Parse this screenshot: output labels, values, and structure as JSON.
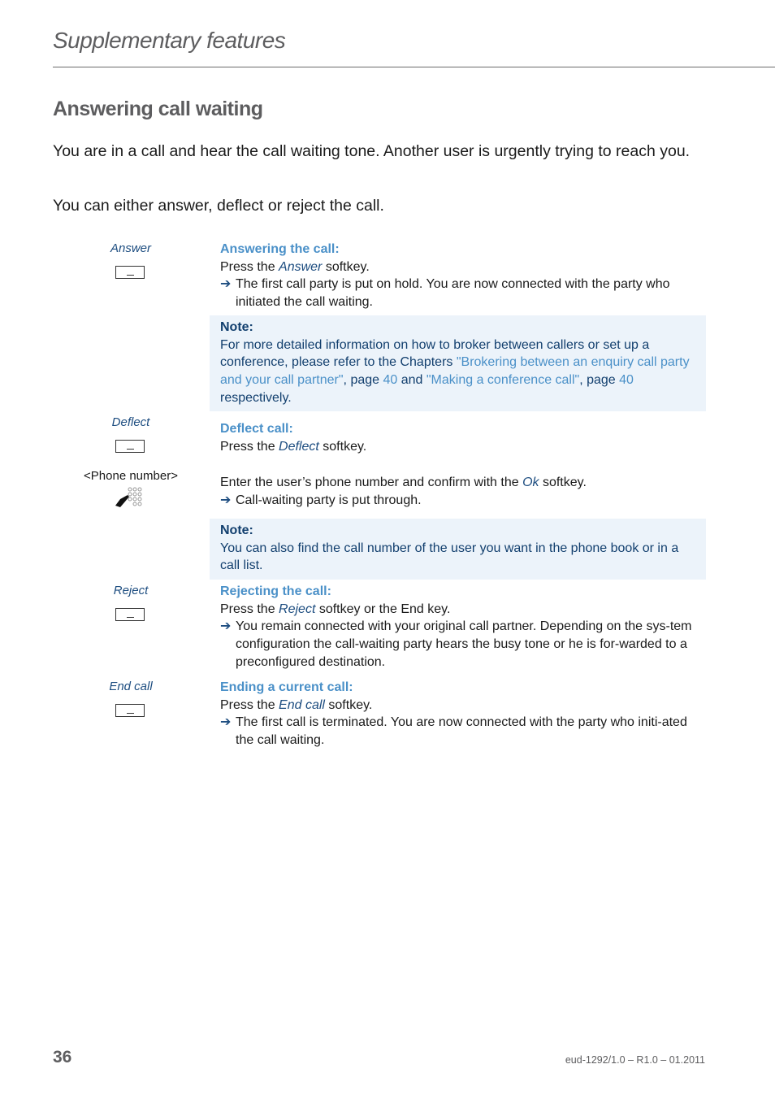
{
  "header": {
    "running_head": "Supplementary features"
  },
  "section": {
    "title": "Answering call waiting",
    "intro_1": "You are in a call and hear the call waiting tone. Another user is urgently trying to reach you.",
    "intro_2": "You can either answer, deflect or reject the call."
  },
  "answer": {
    "key_label": "Answer",
    "key_icon": "softkey-icon",
    "title": "Answering the call:",
    "press_pre": "Press the ",
    "press_key": "Answer",
    "press_post": " softkey.",
    "arrow": "➔",
    "result": "The first call party is put on hold. You are now connected with the party who initiated the call waiting."
  },
  "note1": {
    "title": "Note:",
    "text_1": "For more detailed information on how to broker between callers or set up a conference, please refer to the Chapters ",
    "link_1": "\"Brokering between an enquiry call party and your call partner\"",
    "text_2": ", page ",
    "page_1": "40",
    "text_3": " and ",
    "link_2": "\"Making a conference call\"",
    "text_4": ", page ",
    "page_2": "40",
    "text_5": " respectively."
  },
  "deflect": {
    "key_label": "Deflect",
    "key_icon": "softkey-icon",
    "title": "Deflect call:",
    "press_pre": "Press the ",
    "press_key": "Deflect",
    "press_post": " softkey.",
    "phone_label": "<Phone number>",
    "phone_icon": "keypad-icon",
    "enter_pre": "Enter the user’s phone number and confirm with the ",
    "enter_key": "Ok",
    "enter_post": " softkey.",
    "arrow": "➔",
    "result": "Call-waiting party is put through."
  },
  "note2": {
    "title": "Note:",
    "text": "You can also find the call number of the user you want in the phone book or in a call list."
  },
  "reject": {
    "key_label": "Reject",
    "key_icon": "softkey-icon",
    "title": "Rejecting the call:",
    "press_pre": "Press the ",
    "press_key": "Reject",
    "press_post": " softkey or the End key.",
    "arrow": "➔",
    "result": "You remain connected with your original call partner. Depending on the sys-tem configuration the call-waiting party hears the busy tone or he is for-warded to a preconfigured destination."
  },
  "endcall": {
    "key_label": "End call",
    "key_icon": "softkey-icon",
    "title": "Ending a current call:",
    "press_pre": "Press the ",
    "press_key": "End call",
    "press_post": " softkey.",
    "arrow": "➔",
    "result": "The first call is terminated. You are now connected with the party who initi-ated the call waiting."
  },
  "footer": {
    "page_number": "36",
    "doc_id": "eud-1292/1.0 – R1.0 – 01.2011"
  },
  "colors": {
    "heading_gray": "#5d5d5f",
    "accent_blue": "#4a90c8",
    "dark_blue": "#1d4d80",
    "note_bg": "#ecf3fa"
  }
}
